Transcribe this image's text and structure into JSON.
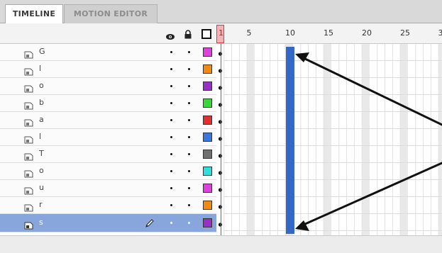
{
  "tabs": [
    {
      "label": "TIMELINE",
      "active": true
    },
    {
      "label": "MOTION EDITOR",
      "active": false
    }
  ],
  "header": {
    "icons": [
      "eye-icon",
      "lock-icon",
      "outline-icon"
    ],
    "ruler_numbers": [
      "5",
      "10",
      "15",
      "20",
      "25",
      "3"
    ],
    "playhead_label": "1"
  },
  "layers": [
    {
      "name": "G",
      "color": "#e040e0",
      "selected": false
    },
    {
      "name": "l",
      "color": "#f08a10",
      "selected": false
    },
    {
      "name": "o",
      "color": "#9a2ec8",
      "selected": false
    },
    {
      "name": "b",
      "color": "#38d838",
      "selected": false
    },
    {
      "name": "a",
      "color": "#e03030",
      "selected": false
    },
    {
      "name": "l",
      "color": "#3a78e0",
      "selected": false
    },
    {
      "name": "T",
      "color": "#707070",
      "selected": false
    },
    {
      "name": "o",
      "color": "#30dede",
      "selected": false
    },
    {
      "name": "u",
      "color": "#e040e0",
      "selected": false
    },
    {
      "name": "r",
      "color": "#f08a10",
      "selected": false
    },
    {
      "name": "s",
      "color": "#9a2ec8",
      "selected": true
    }
  ],
  "colors": {
    "selection": "#88a6dc",
    "frame_highlight": "#3568c6",
    "playhead": "#d04040"
  }
}
